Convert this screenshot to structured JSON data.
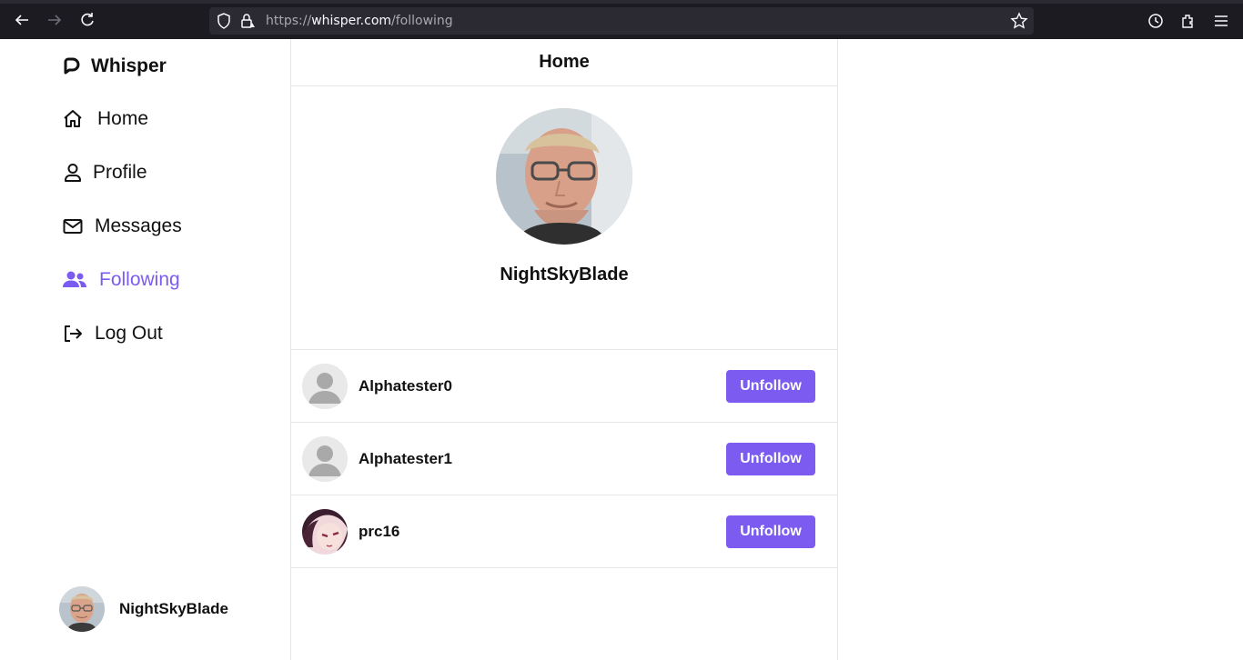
{
  "browser": {
    "url_prefix": "https://",
    "url_domain": "whisper.com",
    "url_path": "/following"
  },
  "sidebar": {
    "brand": "Whisper",
    "items": [
      {
        "label": "Home",
        "icon": "home-icon"
      },
      {
        "label": "Profile",
        "icon": "user-icon"
      },
      {
        "label": "Messages",
        "icon": "envelope-icon"
      },
      {
        "label": "Following",
        "icon": "users-icon",
        "active": true
      },
      {
        "label": "Log Out",
        "icon": "logout-icon"
      }
    ],
    "account_name": "NightSkyBlade"
  },
  "main": {
    "title": "Home",
    "profile_name": "NightSkyBlade",
    "following": [
      {
        "name": "Alphatester0",
        "action": "Unfollow",
        "avatar": "default-avatar-icon"
      },
      {
        "name": "Alphatester1",
        "action": "Unfollow",
        "avatar": "default-avatar-icon"
      },
      {
        "name": "prc16",
        "action": "Unfollow",
        "avatar": "anime-avatar"
      }
    ]
  },
  "colors": {
    "accent": "#7c5cf0",
    "browser_bg": "#1c1b22",
    "border": "#e6e6e6"
  }
}
